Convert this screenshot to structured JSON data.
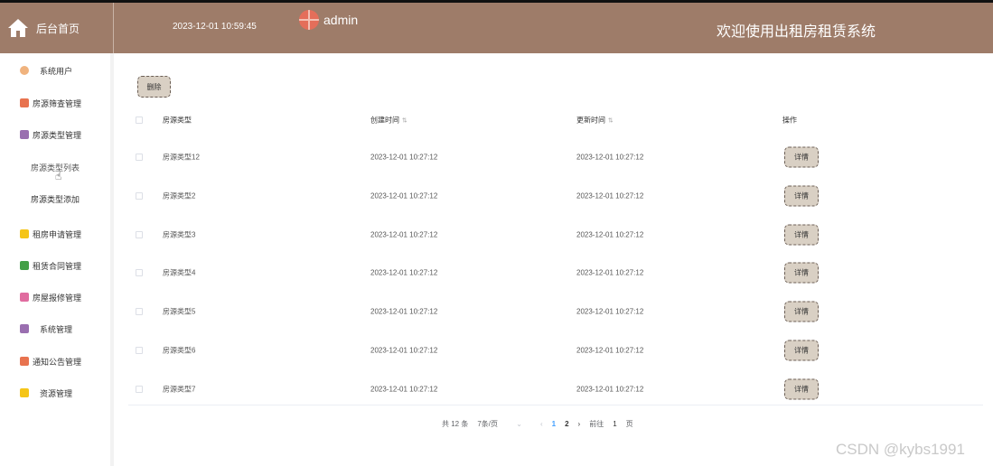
{
  "header": {
    "home_label": "后台首页",
    "datetime": "2023-12-01 10:59:45",
    "username": "admin",
    "site_title": "欢迎使用出租房租赁系统",
    "bg_color": "#9e7c69"
  },
  "sidebar": {
    "items": [
      {
        "label": "系统用户",
        "icon": "user-gear-icon",
        "color": "#f0b37e"
      },
      {
        "label": "房源筛查管理",
        "icon": "grid-icon",
        "color": "#e8734f"
      },
      {
        "label": "房源类型管理",
        "icon": "box-icon",
        "color": "#9a6fb0"
      },
      {
        "label": "租房申请管理",
        "icon": "cube-icon",
        "color": "#f5c518"
      },
      {
        "label": "租赁合同管理",
        "icon": "monitor-icon",
        "color": "#43a047"
      },
      {
        "label": "房屋报修管理",
        "icon": "document-icon",
        "color": "#e06c9f"
      },
      {
        "label": "系统管理",
        "icon": "box-icon",
        "color": "#9a6fb0"
      },
      {
        "label": "通知公告管理",
        "icon": "grid-icon",
        "color": "#e8734f"
      },
      {
        "label": "资源管理",
        "icon": "cube-icon",
        "color": "#f5c518"
      }
    ],
    "sub_items": [
      {
        "label": "房源类型列表"
      },
      {
        "label": "房源类型添加"
      }
    ]
  },
  "toolbar": {
    "delete_label": "删除"
  },
  "table": {
    "headers": {
      "type": "房源类型",
      "created": "创建时间",
      "updated": "更新时间",
      "action": "操作"
    },
    "rows": [
      {
        "type": "房源类型12",
        "created": "2023-12-01 10:27:12",
        "updated": "2023-12-01 10:27:12",
        "action": "详情"
      },
      {
        "type": "房源类型2",
        "created": "2023-12-01 10:27:12",
        "updated": "2023-12-01 10:27:12",
        "action": "详情"
      },
      {
        "type": "房源类型3",
        "created": "2023-12-01 10:27:12",
        "updated": "2023-12-01 10:27:12",
        "action": "详情"
      },
      {
        "type": "房源类型4",
        "created": "2023-12-01 10:27:12",
        "updated": "2023-12-01 10:27:12",
        "action": "详情"
      },
      {
        "type": "房源类型5",
        "created": "2023-12-01 10:27:12",
        "updated": "2023-12-01 10:27:12",
        "action": "详情"
      },
      {
        "type": "房源类型6",
        "created": "2023-12-01 10:27:12",
        "updated": "2023-12-01 10:27:12",
        "action": "详情"
      },
      {
        "type": "房源类型7",
        "created": "2023-12-01 10:27:12",
        "updated": "2023-12-01 10:27:12",
        "action": "详情"
      }
    ]
  },
  "pagination": {
    "total": "共 12 条",
    "page_size": "7条/页",
    "pages": [
      "1",
      "2"
    ],
    "current": "1",
    "goto_prefix": "前往",
    "goto_value": "1",
    "goto_suffix": "页"
  },
  "watermark": "CSDN @kybs1991"
}
